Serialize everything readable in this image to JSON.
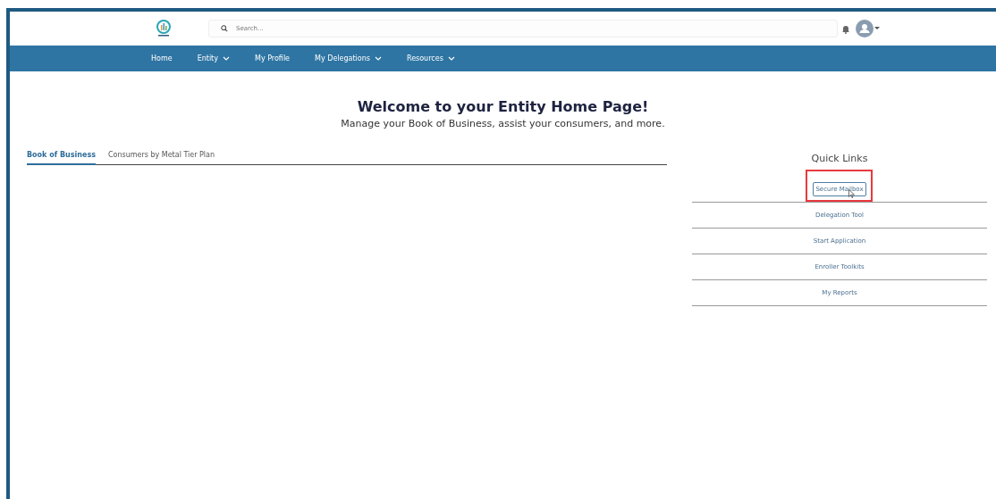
{
  "header": {
    "search": {
      "placeholder": "Search..."
    }
  },
  "nav": [
    {
      "label": "Home",
      "dropdown": false
    },
    {
      "label": "Entity",
      "dropdown": true
    },
    {
      "label": "My Profile",
      "dropdown": false
    },
    {
      "label": "My Delegations",
      "dropdown": true
    },
    {
      "label": "Resources",
      "dropdown": true
    }
  ],
  "welcome": {
    "title": "Welcome to your Entity Home Page!",
    "subtitle": "Manage your Book of Business, assist your consumers, and more."
  },
  "tabs": [
    {
      "label": "Book of Business",
      "selected": true
    },
    {
      "label": "Consumers by Metal Tier Plan",
      "selected": false
    }
  ],
  "quick_links": {
    "title": "Quick Links",
    "items": [
      {
        "label": "Secure Mailbox",
        "selected": true,
        "highlighted": true
      },
      {
        "label": "Delegation Tool",
        "selected": false,
        "highlighted": false
      },
      {
        "label": "Start Application",
        "selected": false,
        "highlighted": false
      },
      {
        "label": "Enroller Toolkits",
        "selected": false,
        "highlighted": false
      },
      {
        "label": "My Reports",
        "selected": false,
        "highlighted": false
      }
    ]
  }
}
